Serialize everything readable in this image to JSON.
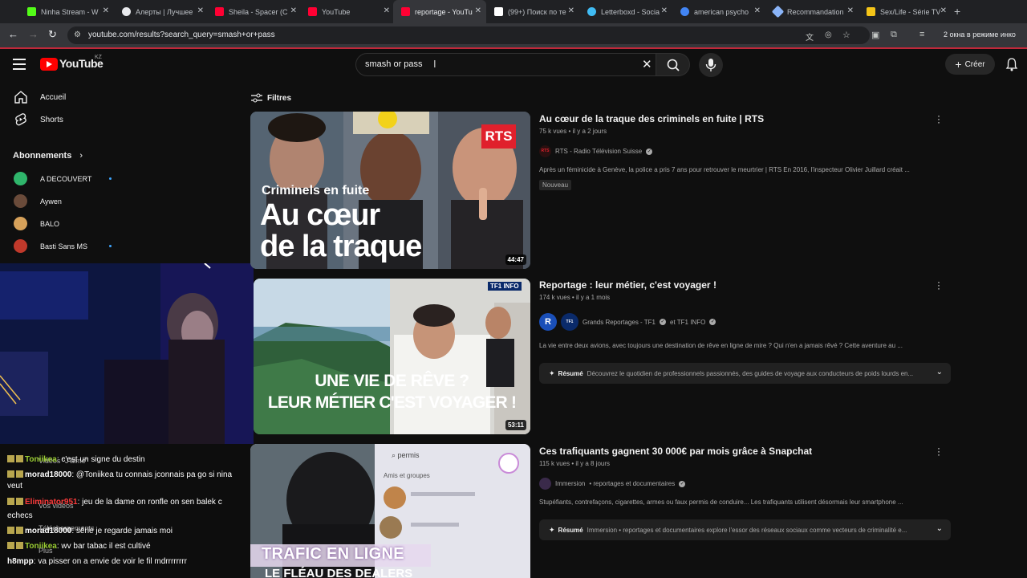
{
  "browser": {
    "tabs": [
      {
        "label": "Ninha Stream - W",
        "favicon_color": "#53fc18"
      },
      {
        "label": "Алерты | Лучшее",
        "favicon_color": "#e8eaed"
      },
      {
        "label": "Sheila - Spacer (C",
        "favicon_color": "#ff0033"
      },
      {
        "label": "YouTube",
        "favicon_color": "#ff0033"
      },
      {
        "label": "reportage - YouTu",
        "favicon_color": "#ff0033"
      },
      {
        "label": "(99+) Поиск по те",
        "favicon_color": "#ffffff"
      },
      {
        "label": "Letterboxd - Socia",
        "favicon_color": "#40bcf4"
      },
      {
        "label": "american psycho",
        "favicon_color": "#4285f4"
      },
      {
        "label": "Recommandation",
        "favicon_color": "#8ab4f8"
      },
      {
        "label": "Sex/Life - Série TV",
        "favicon_color": "#f5c518"
      }
    ],
    "new_tab_label": "+",
    "url": "youtube.com/results?search_query=smash+or+pass",
    "incognito_label": "2 окна в режиме инко"
  },
  "masthead": {
    "logo_text": "YouTube",
    "country_code": "KZ",
    "search_value": "smash or pass",
    "create_label": "Créer"
  },
  "sidebar": {
    "items": [
      {
        "label": "Accueil"
      },
      {
        "label": "Shorts"
      }
    ],
    "subscriptions_heading": "Abonnements",
    "subscriptions": [
      {
        "label": "A DECOUVERT",
        "color": "#2fb56b",
        "new": true
      },
      {
        "label": "Aywen",
        "color": "#6a4b3a",
        "new": false
      },
      {
        "label": "BALO",
        "color": "#d6a15a",
        "new": false
      },
      {
        "label": "Basti Sans MS",
        "color": "#c0392b",
        "new": true
      }
    ],
    "ghost_items": [
      "Vidéos \"J'aime\"",
      "Vos vidéos",
      "Téléchargements",
      "Plus"
    ]
  },
  "chat": {
    "lines": [
      {
        "user": "Toniikea",
        "user_color": "#9acd32",
        "text": ": c'est un signe du destin"
      },
      {
        "user": "morad18000",
        "user_color": "#ffffff",
        "text": ": @Toniikea tu connais jconnais pa go si nina"
      },
      {
        "user": "",
        "user_color": "#ffffff",
        "text": "veut"
      },
      {
        "user": "Eliminator951",
        "user_color": "#ff3b3b",
        "text": ": jeu de la dame on ronfle on sen balek c"
      },
      {
        "user": "",
        "user_color": "#ffffff",
        "text": "echecs"
      },
      {
        "user": "morad18000",
        "user_color": "#ffffff",
        "text": ": série je regarde jamais moi"
      },
      {
        "user": "Toniikea",
        "user_color": "#9acd32",
        "text": ": wv bar tabac il est cultivé"
      },
      {
        "user": "h8mpp",
        "user_color": "#ffffff",
        "text": ": va pisser on a envie de voir le fil mdrrrrrrrr"
      }
    ]
  },
  "results": {
    "filters_label": "Filtres",
    "videos": [
      {
        "title": "Au cœur de la traque des criminels en fuite | RTS",
        "meta": "75 k vues • il y a 2 jours",
        "channel": "RTS - Radio Télévision Suisse",
        "description": "Après un féminicide à Genève, la police a pris 7 ans pour retrouver le meurtrier | RTS En 2016, l'inspecteur Olivier Juillard créait ...",
        "badge": "Nouveau",
        "duration": "44:47",
        "thumb_brand": "RTS",
        "thumb_kicker": "Criminels en fuite",
        "thumb_headline_1": "Au cœur",
        "thumb_headline_2": "de la traque"
      },
      {
        "title": "Reportage : leur métier, c'est voyager !",
        "meta": "174 k vues • il y a 1 mois",
        "channel": "Grands Reportages - TF1",
        "channel_2": "et TF1 INFO",
        "description": "La vie entre deux avions, avec toujours une destination de rêve en ligne de mire ? Qui n'en a jamais rêvé ? Cette aventure au ...",
        "resume_label": "Résumé",
        "resume_text": "Découvrez le quotidien de professionnels passionnés, des guides de voyage aux conducteurs de poids lourds en...",
        "duration": "53:11",
        "thumb_brand": "TF1 INFO",
        "thumb_headline_1": "UNE VIE DE RÊVE ?",
        "thumb_headline_2": "LEUR MÉTIER C'EST VOYAGER !"
      },
      {
        "title": "Ces trafiquants gagnent 30 000€ par mois grâce à Snapchat",
        "meta": "115 k vues • il y a 8 jours",
        "channel": "Immersion",
        "channel_2": "• reportages et documentaires",
        "description": "Stupéfiants, contrefaçons, cigarettes, armes ou faux permis de conduire... Les trafiquants utilisent désormais leur smartphone ...",
        "resume_label": "Résumé",
        "resume_text": "Immersion • reportages et documentaires explore l'essor des réseaux sociaux comme vecteurs de criminalité e...",
        "thumb_search": "permis",
        "thumb_group": "Amis et groupes",
        "thumb_headline_1": "TRAFIC EN LIGNE",
        "thumb_headline_2": "LE FLÉAU DES DEALERS"
      }
    ]
  }
}
